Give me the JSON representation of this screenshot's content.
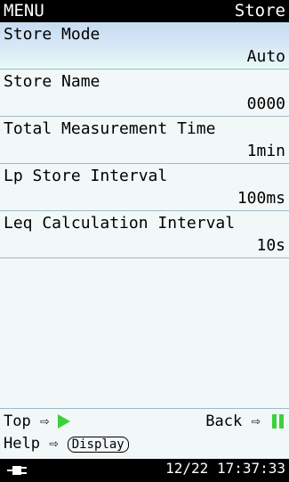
{
  "header": {
    "title": "MENU",
    "page": "Store"
  },
  "menu_items": [
    {
      "label": "Store Mode",
      "value": "Auto"
    },
    {
      "label": "Store Name",
      "value": "0000"
    },
    {
      "label": "Total Measurement Time",
      "value": "1min"
    },
    {
      "label": "Lp Store Interval",
      "value": "100ms"
    },
    {
      "label": "Leq Calculation Interval",
      "value": "10s"
    }
  ],
  "footer": {
    "top_label": "Top",
    "back_label": "Back",
    "help_label": "Help",
    "display_key": "Display"
  },
  "status": {
    "datetime": "12/22 17:37:33",
    "power_icon": "ac-plug-icon"
  },
  "colors": {
    "background": "#f2f8f8",
    "bar": "#000000",
    "accent": "#3bd13b",
    "selected_row": "#c6dbf1"
  }
}
